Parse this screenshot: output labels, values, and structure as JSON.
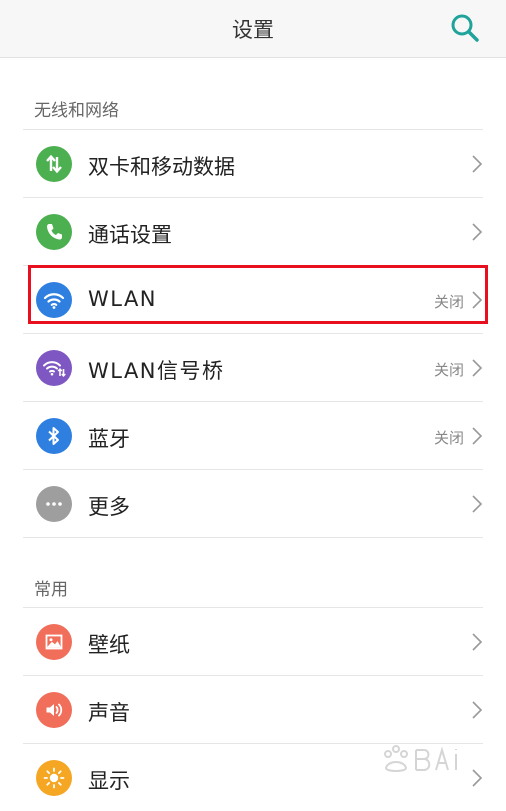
{
  "header": {
    "title": "设置"
  },
  "sections": [
    {
      "title": "无线和网络",
      "items": [
        {
          "label": "双卡和移动数据",
          "status": "",
          "icon": "dual-sim-data-icon",
          "color": "#4caf50"
        },
        {
          "label": "通话设置",
          "status": "",
          "icon": "phone-icon",
          "color": "#4caf50"
        },
        {
          "label": "WLAN",
          "status": "关闭",
          "icon": "wifi-icon",
          "color": "#2f7fe0"
        },
        {
          "label": "WLAN信号桥",
          "status": "关闭",
          "icon": "wifi-bridge-icon",
          "color": "#7e57c2"
        },
        {
          "label": "蓝牙",
          "status": "关闭",
          "icon": "bluetooth-icon",
          "color": "#2f7fe0"
        },
        {
          "label": "更多",
          "status": "",
          "icon": "more-icon",
          "color": "#9e9e9e"
        }
      ]
    },
    {
      "title": "常用",
      "items": [
        {
          "label": "壁纸",
          "status": "",
          "icon": "wallpaper-icon",
          "color": "#f06e5a"
        },
        {
          "label": "声音",
          "status": "",
          "icon": "sound-icon",
          "color": "#f06e5a"
        },
        {
          "label": "显示",
          "status": "",
          "icon": "display-icon",
          "color": "#f5a623"
        }
      ]
    }
  ],
  "colors": {
    "accent": "#1fa39a",
    "highlight": "#e8101e"
  }
}
